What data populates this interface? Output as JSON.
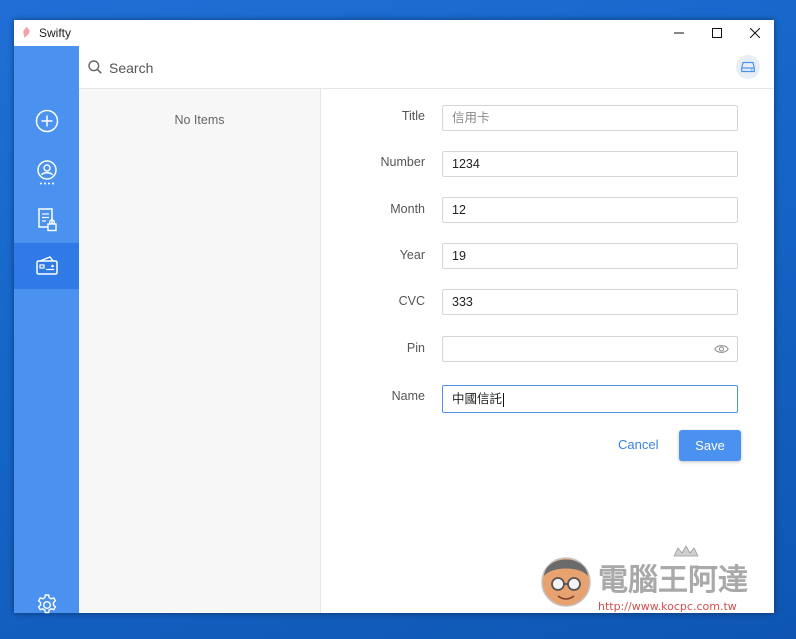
{
  "window": {
    "title": "Swifty",
    "controls": {
      "minimize": "–",
      "maximize": "☐",
      "close": "✕"
    }
  },
  "sidebar": {
    "items": [
      {
        "icon": "add-circle-icon",
        "active": false
      },
      {
        "icon": "account-icon",
        "active": false
      },
      {
        "icon": "note-lock-icon",
        "active": false
      },
      {
        "icon": "credit-card-icon",
        "active": true
      }
    ],
    "settings_icon": "gear-icon"
  },
  "search": {
    "placeholder": "Search"
  },
  "list": {
    "empty_text": "No Items"
  },
  "form": {
    "fields": [
      {
        "label": "Title",
        "value": "信用卡"
      },
      {
        "label": "Number",
        "value": "1234"
      },
      {
        "label": "Month",
        "value": "12"
      },
      {
        "label": "Year",
        "value": "19"
      },
      {
        "label": "CVC",
        "value": "333"
      },
      {
        "label": "Pin",
        "value": ""
      },
      {
        "label": "Name",
        "value": "中國信託"
      }
    ],
    "cancel_label": "Cancel",
    "save_label": "Save"
  },
  "watermark": {
    "title": "電腦王阿達",
    "url": "http://www.kocpc.com.tw"
  },
  "colors": {
    "accent": "#4a91f0",
    "sidebar_active": "#2f7ae6",
    "desktop": "#1565c8"
  }
}
